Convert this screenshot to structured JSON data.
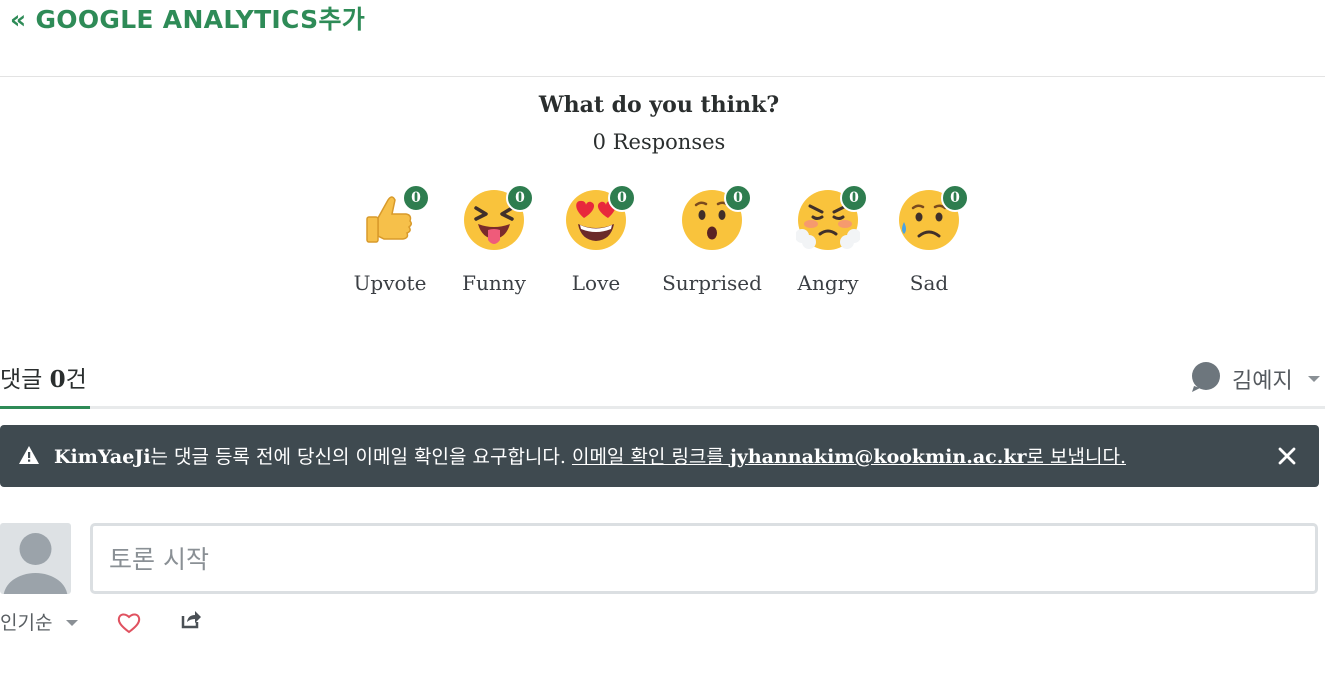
{
  "header": {
    "back_link": "« GOOGLE ANALYTICS추가"
  },
  "reactions": {
    "title": "What do you think?",
    "responses": "0 Responses",
    "items": [
      {
        "label": "Upvote",
        "count": "0",
        "icon": "thumbs-up-icon"
      },
      {
        "label": "Funny",
        "count": "0",
        "icon": "funny-face-icon"
      },
      {
        "label": "Love",
        "count": "0",
        "icon": "heart-eyes-icon"
      },
      {
        "label": "Surprised",
        "count": "0",
        "icon": "surprised-face-icon"
      },
      {
        "label": "Angry",
        "count": "0",
        "icon": "angry-face-icon"
      },
      {
        "label": "Sad",
        "count": "0",
        "icon": "sad-face-icon"
      }
    ]
  },
  "comments": {
    "tab_prefix": "댓글 ",
    "tab_count": "0",
    "tab_suffix": "건",
    "user_name": "김예지"
  },
  "alert": {
    "site": "KimYaeJi",
    "text1": "는 댓글 등록 전에 당신의 이메일 확인을 요구합니다. ",
    "link_part1": "이메일 확인 링크를 ",
    "email": "jyhannakim@kookmin.ac.kr",
    "link_part2": "로 보냅니다."
  },
  "composer": {
    "placeholder": "토론 시작"
  },
  "footer": {
    "sort_label": "인기순"
  },
  "colors": {
    "accent": "#2e8b57",
    "badge": "#2e7d4f",
    "alert_bg": "#3f4a50"
  }
}
